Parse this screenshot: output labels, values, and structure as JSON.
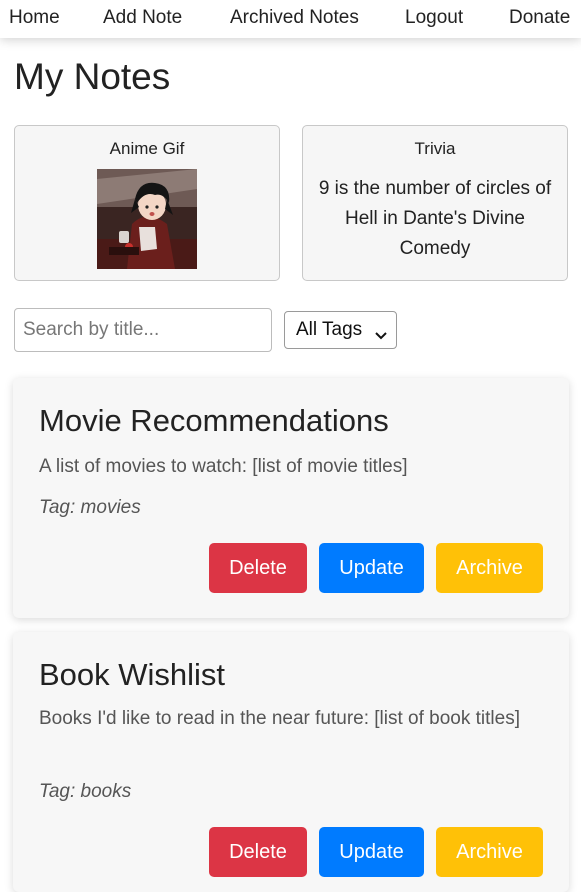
{
  "nav": {
    "items": [
      {
        "label": "Home"
      },
      {
        "label": "Add Note"
      },
      {
        "label": "Archived Notes"
      },
      {
        "label": "Logout"
      },
      {
        "label": "Donate"
      }
    ]
  },
  "page": {
    "title": "My Notes"
  },
  "widgets": {
    "anime": {
      "title": "Anime Gif"
    },
    "trivia": {
      "title": "Trivia",
      "text": "9 is the number of circles of Hell in Dante's Divine Comedy"
    }
  },
  "filters": {
    "search_placeholder": "Search by title...",
    "search_value": "",
    "tag_selected": "All Tags"
  },
  "notes": [
    {
      "title": "Movie Recommendations",
      "body": "A list of movies to watch: [list of movie titles]",
      "tag": "Tag: movies"
    },
    {
      "title": "Book Wishlist",
      "body": "Books I'd like to read in the near future: [list of book titles]",
      "tag": "Tag: books"
    }
  ],
  "actions": {
    "delete_label": "Delete",
    "update_label": "Update",
    "archive_label": "Archive"
  },
  "colors": {
    "delete": "#dc3545",
    "update": "#007bff",
    "archive": "#ffc107"
  }
}
